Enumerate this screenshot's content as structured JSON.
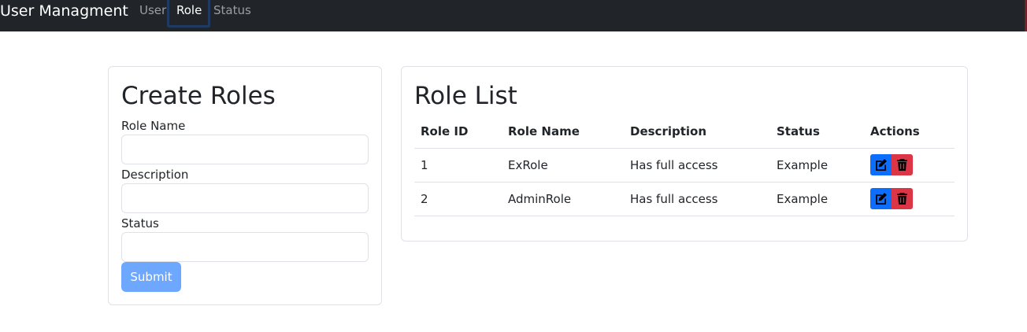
{
  "navbar": {
    "brand": "User Managment",
    "links": [
      "User",
      "Role",
      "Status"
    ],
    "active": "Role"
  },
  "create": {
    "title": "Create Roles",
    "fields": [
      {
        "label": "Role Name",
        "value": ""
      },
      {
        "label": "Description",
        "value": ""
      },
      {
        "label": "Status",
        "value": ""
      }
    ],
    "submit_label": "Submit"
  },
  "list": {
    "title": "Role List",
    "headers": [
      "Role ID",
      "Role Name",
      "Description",
      "Status",
      "Actions"
    ],
    "rows": [
      {
        "id": "1",
        "name": "ExRole",
        "description": "Has full access",
        "status": "Example"
      },
      {
        "id": "2",
        "name": "AdminRole",
        "description": "Has full access",
        "status": "Example"
      }
    ],
    "icons": {
      "edit": "edit-icon",
      "delete": "trash-icon"
    }
  },
  "colors": {
    "navbar_bg": "#212529",
    "primary": "#0d6efd",
    "danger": "#dc3545",
    "submit_bg": "#6ea8fe"
  }
}
